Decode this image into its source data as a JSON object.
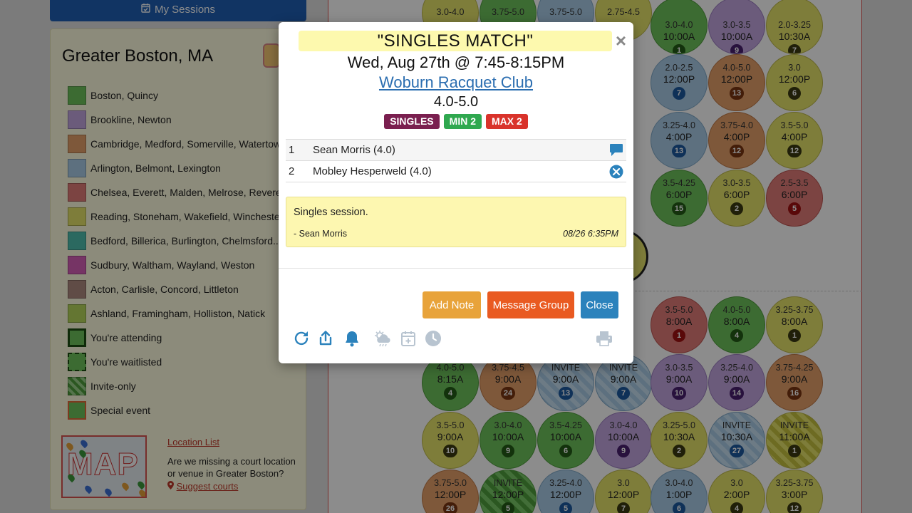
{
  "header": {
    "my_sessions_label": "My Sessions"
  },
  "sidebar": {
    "title": "Greater Boston, MA",
    "legend": [
      {
        "label": "Boston, Quincy",
        "color": "#6ec45b"
      },
      {
        "label": "Brookline, Newton",
        "color": "#c4a7e1"
      },
      {
        "label": "Cambridge, Medford, Somerville, Watertown",
        "color": "#e6a06a"
      },
      {
        "label": "Arlington, Belmont, Lexington",
        "color": "#a9cde8"
      },
      {
        "label": "Chelsea, Everett, Malden, Melrose, Revere",
        "color": "#e27c78"
      },
      {
        "label": "Reading, Stoneham, Wakefield, Winchester",
        "color": "#e6e46a"
      },
      {
        "label": "Bedford, Billerica, Burlington, Chelmsford...",
        "color": "#4fc0b0"
      },
      {
        "label": "Sudbury, Waltham, Wayland, Weston",
        "color": "#d75fb8"
      },
      {
        "label": "Acton, Carlisle, Concord, Littleton",
        "color": "#b08a80"
      },
      {
        "label": "Ashland, Framingham, Holliston, Natick",
        "color": "#b6d85b"
      },
      {
        "label": "You're attending",
        "color": "#6ec45b"
      },
      {
        "label": "You're waitlisted",
        "color": "#6ec45b"
      },
      {
        "label": "Invite-only",
        "color": "#6ec45b"
      },
      {
        "label": "Special event",
        "color": "#6ec45b"
      }
    ],
    "map_label": "MAP",
    "location_link": "Location List",
    "missing_text": "Are we missing a court location or venue in Greater Boston?",
    "suggest_label": "Suggest courts"
  },
  "calendar": {
    "bubbles": [
      {
        "level": "3.0-4.0",
        "time": "",
        "count": "",
        "color": "yellow"
      },
      {
        "level": "3.75-5.0",
        "time": "",
        "count": "",
        "color": "green"
      },
      {
        "level": "3.75-5.0",
        "time": "",
        "count": "",
        "color": "blue"
      },
      {
        "level": "2.75-4.5",
        "time": "",
        "count": "",
        "color": "yellow"
      },
      {
        "level": "3.0-4.0",
        "time": "10:00A",
        "count": "1",
        "color": "green"
      },
      {
        "level": "3.0-3.5",
        "time": "10:00A",
        "count": "9",
        "color": "purple"
      },
      {
        "level": "2.0-3.25",
        "time": "10:30A",
        "count": "7",
        "color": "yellow"
      },
      {
        "level": "2.0-2.5",
        "time": "12:00P",
        "count": "7",
        "color": "blue"
      },
      {
        "level": "4.0-5.0",
        "time": "12:00P",
        "count": "13",
        "color": "orange"
      },
      {
        "level": "3.0",
        "time": "12:00P",
        "count": "6",
        "color": "yellow"
      },
      {
        "level": "3.25-4.0",
        "time": "4:00P",
        "count": "13",
        "color": "blue"
      },
      {
        "level": "3.75-4.0",
        "time": "4:00P",
        "count": "12",
        "color": "orange"
      },
      {
        "level": "3.5-5.0",
        "time": "4:00P",
        "count": "12",
        "color": "yellow"
      },
      {
        "level": "3.5-4.25",
        "time": "6:00P",
        "count": "15",
        "color": "green"
      },
      {
        "level": "3.0-3.5",
        "time": "6:00P",
        "count": "2",
        "color": "yellow"
      },
      {
        "level": "2.5-3.5",
        "time": "6:00P",
        "count": "5",
        "color": "red"
      },
      {
        "level": "3.5-5.0",
        "time": "8:00A",
        "count": "1",
        "color": "red"
      },
      {
        "level": "4.0-5.0",
        "time": "8:00A",
        "count": "4",
        "color": "green"
      },
      {
        "level": "3.25-3.75",
        "time": "8:00A",
        "count": "1",
        "color": "yellow"
      },
      {
        "level": "4.0-5.0",
        "time": "8:15A",
        "count": "4",
        "color": "green"
      },
      {
        "level": "3.75-4.5",
        "time": "9:00A",
        "count": "24",
        "color": "orange"
      },
      {
        "level": "INVITE",
        "time": "9:00A",
        "count": "13",
        "color": "striped-blue"
      },
      {
        "level": "INVITE",
        "time": "9:00A",
        "count": "7",
        "color": "striped-blue"
      },
      {
        "level": "3.0-3.5",
        "time": "9:00A",
        "count": "10",
        "color": "purple"
      },
      {
        "level": "3.25-4.0",
        "time": "9:00A",
        "count": "14",
        "color": "purple"
      },
      {
        "level": "3.75-4.25",
        "time": "9:00A",
        "count": "16",
        "color": "orange"
      },
      {
        "level": "3.5-5.0",
        "time": "9:00A",
        "count": "10",
        "color": "yellow"
      },
      {
        "level": "3.0-4.0",
        "time": "10:00A",
        "count": "9",
        "color": "green"
      },
      {
        "level": "3.5-4.25",
        "time": "10:00A",
        "count": "6",
        "color": "green"
      },
      {
        "level": "3.0-4.0",
        "time": "10:00A",
        "count": "9",
        "color": "purple"
      },
      {
        "level": "3.25-5.0",
        "time": "10:30A",
        "count": "2",
        "color": "yellow"
      },
      {
        "level": "INVITE",
        "time": "10:30A",
        "count": "27",
        "color": "striped-blue"
      },
      {
        "level": "INVITE",
        "time": "11:00A",
        "count": "1",
        "color": "striped-yellow"
      },
      {
        "level": "3.75-5.0",
        "time": "12:00P",
        "count": "26",
        "color": "orange"
      },
      {
        "level": "INVITE",
        "time": "12:00P",
        "count": "5",
        "color": "striped-green"
      },
      {
        "level": "3.25-4.0",
        "time": "12:00P",
        "count": "5",
        "color": "blue"
      },
      {
        "level": "3.0",
        "time": "12:00P",
        "count": "7",
        "color": "yellow"
      },
      {
        "level": "3.0-4.0",
        "time": "1:00P",
        "count": "6",
        "color": "blue"
      },
      {
        "level": "3.0",
        "time": "2:00P",
        "count": "4",
        "color": "yellow"
      },
      {
        "level": "3.25-3.75",
        "time": "3:00P",
        "count": "12",
        "color": "yellow"
      }
    ]
  },
  "modal": {
    "title": "\"SINGLES MATCH\"",
    "date": "Wed, Aug 27th @ 7:45-8:15PM",
    "venue": "Woburn Racquet Club",
    "level": "4.0-5.0",
    "badges": {
      "type": "SINGLES",
      "min": "MIN 2",
      "max": "MAX 2"
    },
    "roster": [
      {
        "num": "1",
        "name": "Sean Morris (4.0)",
        "action_icon": "chat-icon"
      },
      {
        "num": "2",
        "name": "Mobley Hesperweld (4.0)",
        "action_icon": "remove-circle-icon"
      }
    ],
    "note": {
      "text": "Singles session.",
      "author": "- Sean Morris",
      "time": "08/26 6:35PM"
    },
    "buttons": {
      "add_note": "Add Note",
      "message_group": "Message Group",
      "close": "Close"
    },
    "tools": [
      "refresh-icon",
      "share-icon",
      "bell-icon",
      "weather-icon",
      "calendar-add-icon",
      "clock-icon",
      "print-icon"
    ],
    "colors": {
      "accent": "#2b82bc",
      "title_bg": "#fdf9ae",
      "note_bg": "#fdf7b0"
    }
  }
}
